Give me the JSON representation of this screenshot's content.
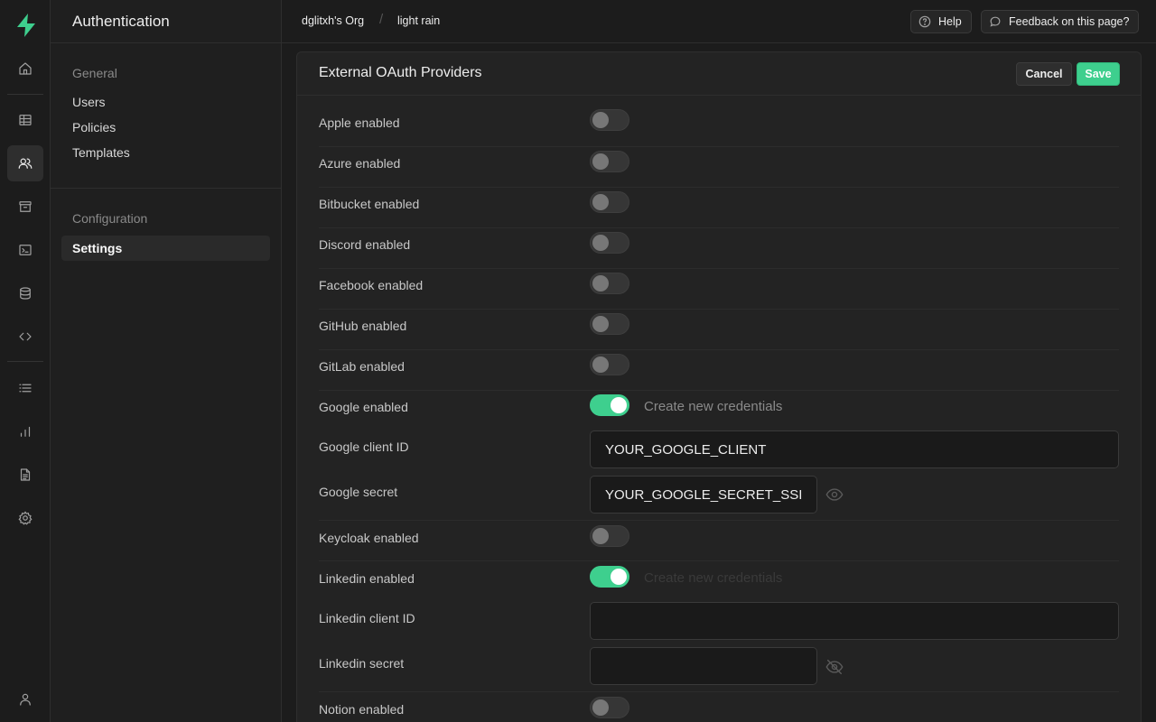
{
  "menu": {
    "title": "Authentication",
    "groups": [
      {
        "title": "General",
        "items": [
          "Users",
          "Policies",
          "Templates"
        ]
      },
      {
        "title": "Configuration",
        "items": [
          "Settings"
        ]
      }
    ]
  },
  "breadcrumb": {
    "org": "dglitxh's Org",
    "sep": "/",
    "project": "light rain"
  },
  "top_buttons": {
    "help": "Help",
    "feedback": "Feedback on this page?"
  },
  "panel": {
    "title": "External OAuth Providers",
    "cancel_label": "Cancel",
    "save_label": "Save"
  },
  "providers": {
    "apple": {
      "label": "Apple enabled",
      "enabled": false
    },
    "azure": {
      "label": "Azure enabled",
      "enabled": false
    },
    "bitbucket": {
      "label": "Bitbucket enabled",
      "enabled": false
    },
    "discord": {
      "label": "Discord enabled",
      "enabled": false
    },
    "facebook": {
      "label": "Facebook enabled",
      "enabled": false
    },
    "github": {
      "label": "GitHub enabled",
      "enabled": false
    },
    "gitlab": {
      "label": "GitLab enabled",
      "enabled": false
    },
    "google": {
      "label": "Google enabled",
      "enabled": true,
      "link": "Create new credentials",
      "client_id_label": "Google client ID",
      "client_id_value": "YOUR_GOOGLE_CLIENT",
      "secret_label": "Google secret",
      "secret_value": "YOUR_GOOGLE_SECRET_SSI"
    },
    "keycloak": {
      "label": "Keycloak enabled",
      "enabled": false
    },
    "linkedin": {
      "label": "Linkedin enabled",
      "enabled": true,
      "link": "Create new credentials",
      "client_id_label": "Linkedin client ID",
      "client_id_value": "",
      "secret_label": "Linkedin secret",
      "secret_value": ""
    },
    "notion": {
      "label": "Notion enabled",
      "enabled": false
    }
  },
  "colors": {
    "accent": "#3ecf8e",
    "background": "#1c1c1c",
    "panel": "#232323"
  }
}
